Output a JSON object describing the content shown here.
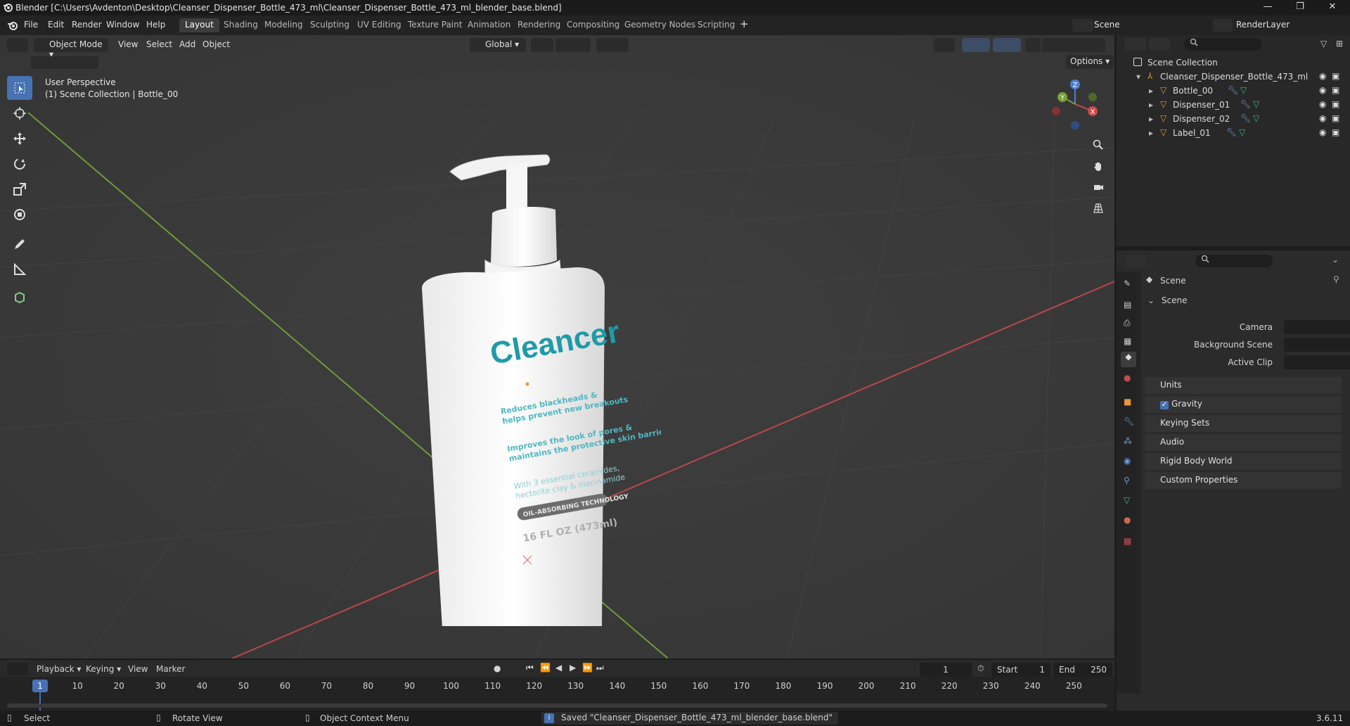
{
  "window": {
    "title": "Blender [C:\\Users\\Avdenton\\Desktop\\Cleanser_Dispenser_Bottle_473_ml\\Cleanser_Dispenser_Bottle_473_ml_blender_base.blend]",
    "minimize": "—",
    "maximize": "❐",
    "close": "✕"
  },
  "menu": [
    "File",
    "Edit",
    "Render",
    "Window",
    "Help"
  ],
  "workspaces": [
    "Layout",
    "Shading",
    "Modeling",
    "Sculpting",
    "UV Editing",
    "Texture Paint",
    "Animation",
    "Rendering",
    "Compositing",
    "Geometry Nodes",
    "Scripting"
  ],
  "active_workspace": "Layout",
  "scene_selector": "Scene",
  "render_layer": "RenderLayer",
  "viewport": {
    "mode": "Object Mode",
    "menus": [
      "View",
      "Select",
      "Add",
      "Object"
    ],
    "transform_orientation": "Global",
    "options_label": "Options",
    "perspective_label": "User Perspective",
    "collection_label": "(1) Scene Collection | Bottle_00"
  },
  "product": {
    "brand": "Cleancer",
    "line1": "Reduces blackheads &",
    "line2": "helps prevent new breakouts",
    "line3": "Improves the look of pores &",
    "line4": "maintains the protective skin barrier",
    "line5": "With 3 essential ceramides,",
    "line6": "hectorite clay & niacinamide",
    "badge": "OIL-ABSORBING TECHNOLOGY",
    "volume": "16 FL OZ (473ml)"
  },
  "outliner": {
    "root": "Scene Collection",
    "collection": "Cleanser_Dispenser_Bottle_473_ml",
    "objects": [
      "Bottle_00",
      "Dispenser_01",
      "Dispenser_02",
      "Label_01"
    ]
  },
  "properties": {
    "header": "Scene",
    "panel": "Scene",
    "camera_label": "Camera",
    "bg_scene_label": "Background Scene",
    "active_clip_label": "Active Clip",
    "sections": [
      "Units",
      "Gravity",
      "Keying Sets",
      "Audio",
      "Rigid Body World",
      "Custom Properties"
    ]
  },
  "timeline": {
    "menus": [
      "Playback",
      "Keying",
      "View",
      "Marker"
    ],
    "current_frame": "1",
    "start_label": "Start",
    "start": "1",
    "end_label": "End",
    "end": "250",
    "ticks": [
      "1",
      "10",
      "20",
      "30",
      "40",
      "50",
      "60",
      "70",
      "80",
      "90",
      "100",
      "110",
      "120",
      "130",
      "140",
      "150",
      "160",
      "170",
      "180",
      "190",
      "200",
      "210",
      "220",
      "230",
      "240",
      "250"
    ]
  },
  "statusbar": {
    "select": "Select",
    "rotate": "Rotate View",
    "context": "Object Context Menu",
    "message": "Saved \"Cleanser_Dispenser_Bottle_473_ml_blender_base.blend\"",
    "version": "3.6.11"
  },
  "colors": {
    "accent": "#4772b3",
    "x_axis": "#c94a4a",
    "y_axis": "#7aa03a",
    "brand_teal": "#1f9aa8",
    "object_orange": "#e8973a",
    "mesh_green": "#2fbf8a"
  }
}
